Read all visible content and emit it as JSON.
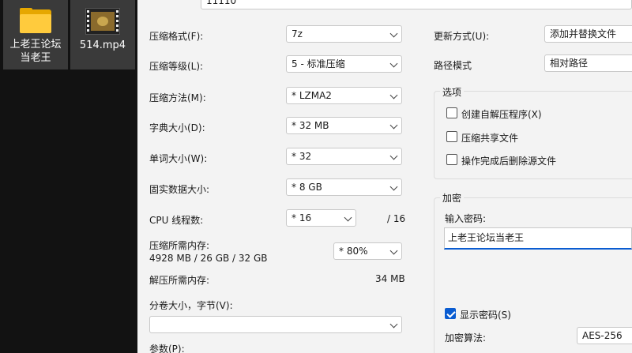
{
  "desktop": {
    "items": [
      {
        "label_line1": "上老王论坛",
        "label_line2": "当老王",
        "icon": "folder-icon"
      },
      {
        "label": "514.mp4",
        "icon": "video-file-icon"
      }
    ]
  },
  "dialog": {
    "top_field_value": "11110",
    "left": {
      "format_label": "压缩格式(F):",
      "format_value": "7z",
      "level_label": "压缩等级(L):",
      "level_value": "5 - 标准压缩",
      "method_label": "压缩方法(M):",
      "method_value": "*  LZMA2",
      "dict_label": "字典大小(D):",
      "dict_value": "*  32 MB",
      "word_label": "单词大小(W):",
      "word_value": "*  32",
      "solid_label": "固实数据大小:",
      "solid_value": "*  8 GB",
      "threads_label": "CPU 线程数:",
      "threads_value": "*  16",
      "threads_total": "/ 16",
      "mem_label": "压缩所需内存:",
      "mem_detail": "4928 MB / 26 GB / 32 GB",
      "mem_percent": "*  80%",
      "decomp_mem_label": "解压所需内存:",
      "decomp_mem_value": "34 MB",
      "volume_label": "分卷大小，字节(V):",
      "volume_value": "",
      "params_label": "参数(P):"
    },
    "right": {
      "update_label": "更新方式(U):",
      "update_value": "添加并替换文件",
      "path_label": "路径模式",
      "path_value": "相对路径",
      "options_title": "选项",
      "opt_sfx": "创建自解压程序(X)",
      "opt_shared": "压缩共享文件",
      "opt_delete": "操作完成后删除源文件",
      "enc_title": "加密",
      "pw_label": "输入密码:",
      "pw_value": "上老王论坛当老王",
      "show_pw": "显示密码(S)",
      "enc_method_label": "加密算法:",
      "enc_method_value": "AES-256"
    }
  }
}
